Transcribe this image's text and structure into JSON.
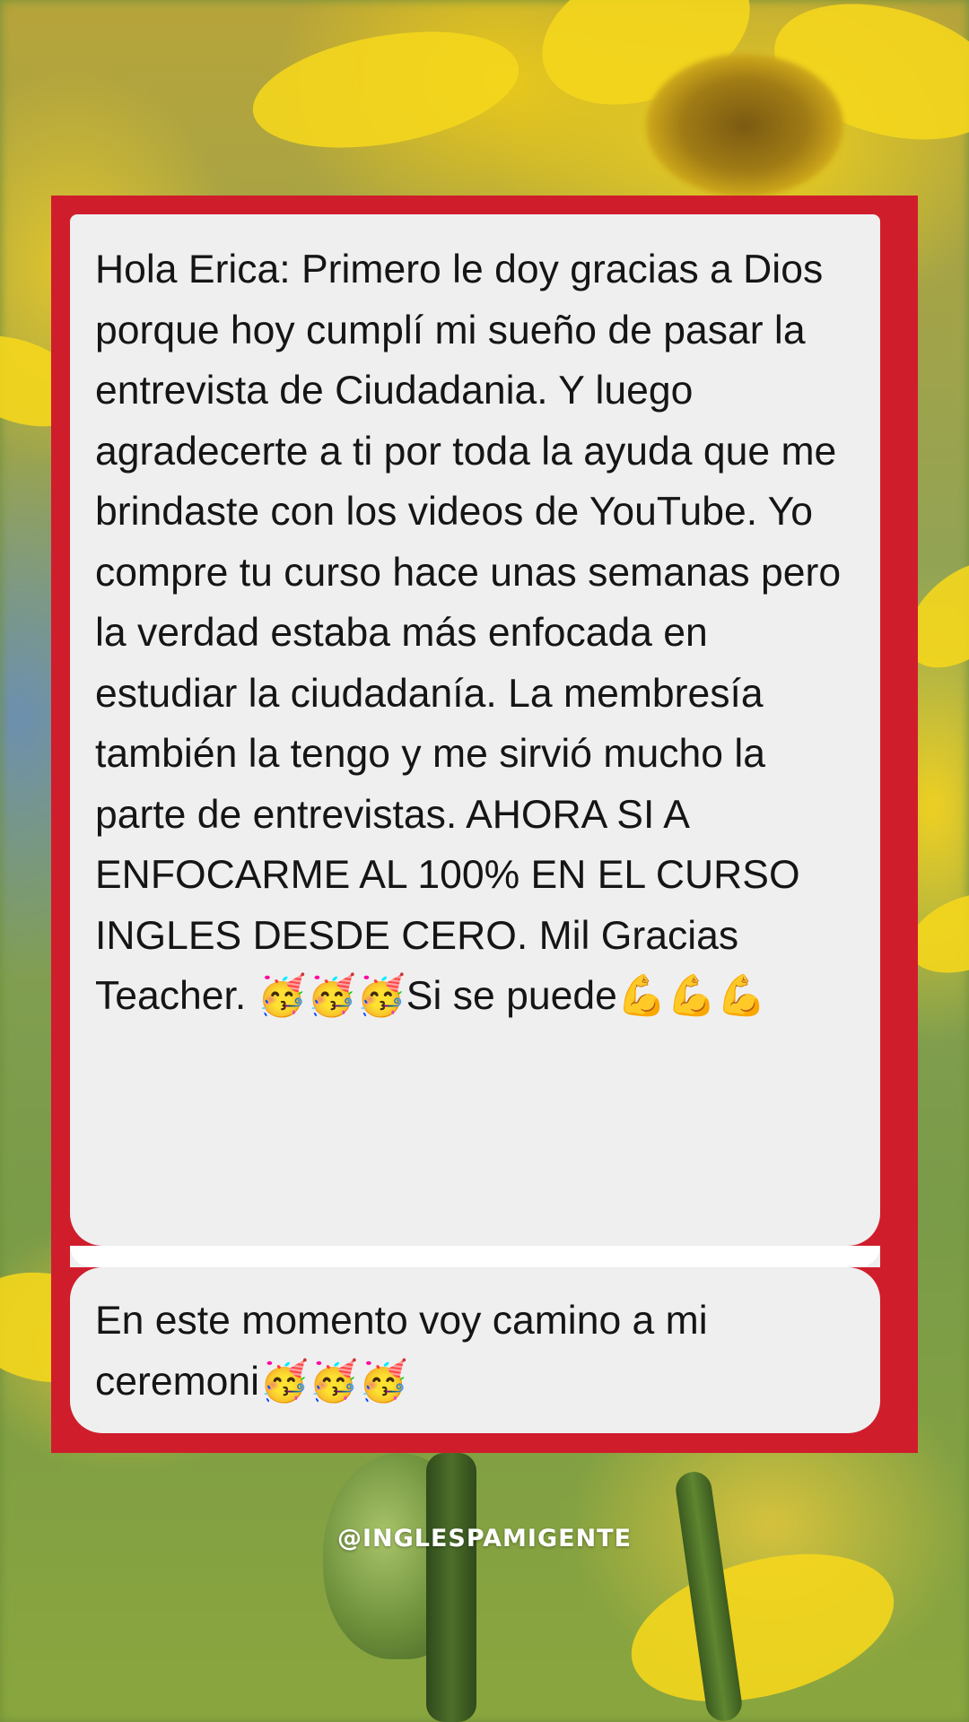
{
  "background": {
    "description_icon": "sunflower-background",
    "accent_color": "#cf1d2c"
  },
  "messages": [
    {
      "text": "Hola Erica: Primero le doy gracias a Dios porque hoy cumplí mi sueño de pasar la entrevista de Ciudadania. Y luego agradecerte a ti por toda la ayuda que me brindaste con los videos de YouTube. Yo compre tu curso hace unas semanas pero la verdad estaba más enfocada en estudiar la ciudadanía. La membresía también la tengo y me sirvió mucho la parte de entrevistas. AHORA SI A ENFOCARME AL 100% EN EL CURSO INGLES DESDE CERO. Mil Gracias Teacher. 🥳🥳🥳Si se puede💪💪💪"
    },
    {
      "text": "En este momento voy camino a mi ceremoni🥳🥳🥳"
    }
  ],
  "footer": {
    "handle": "@INGLESPAMIGENTE"
  }
}
